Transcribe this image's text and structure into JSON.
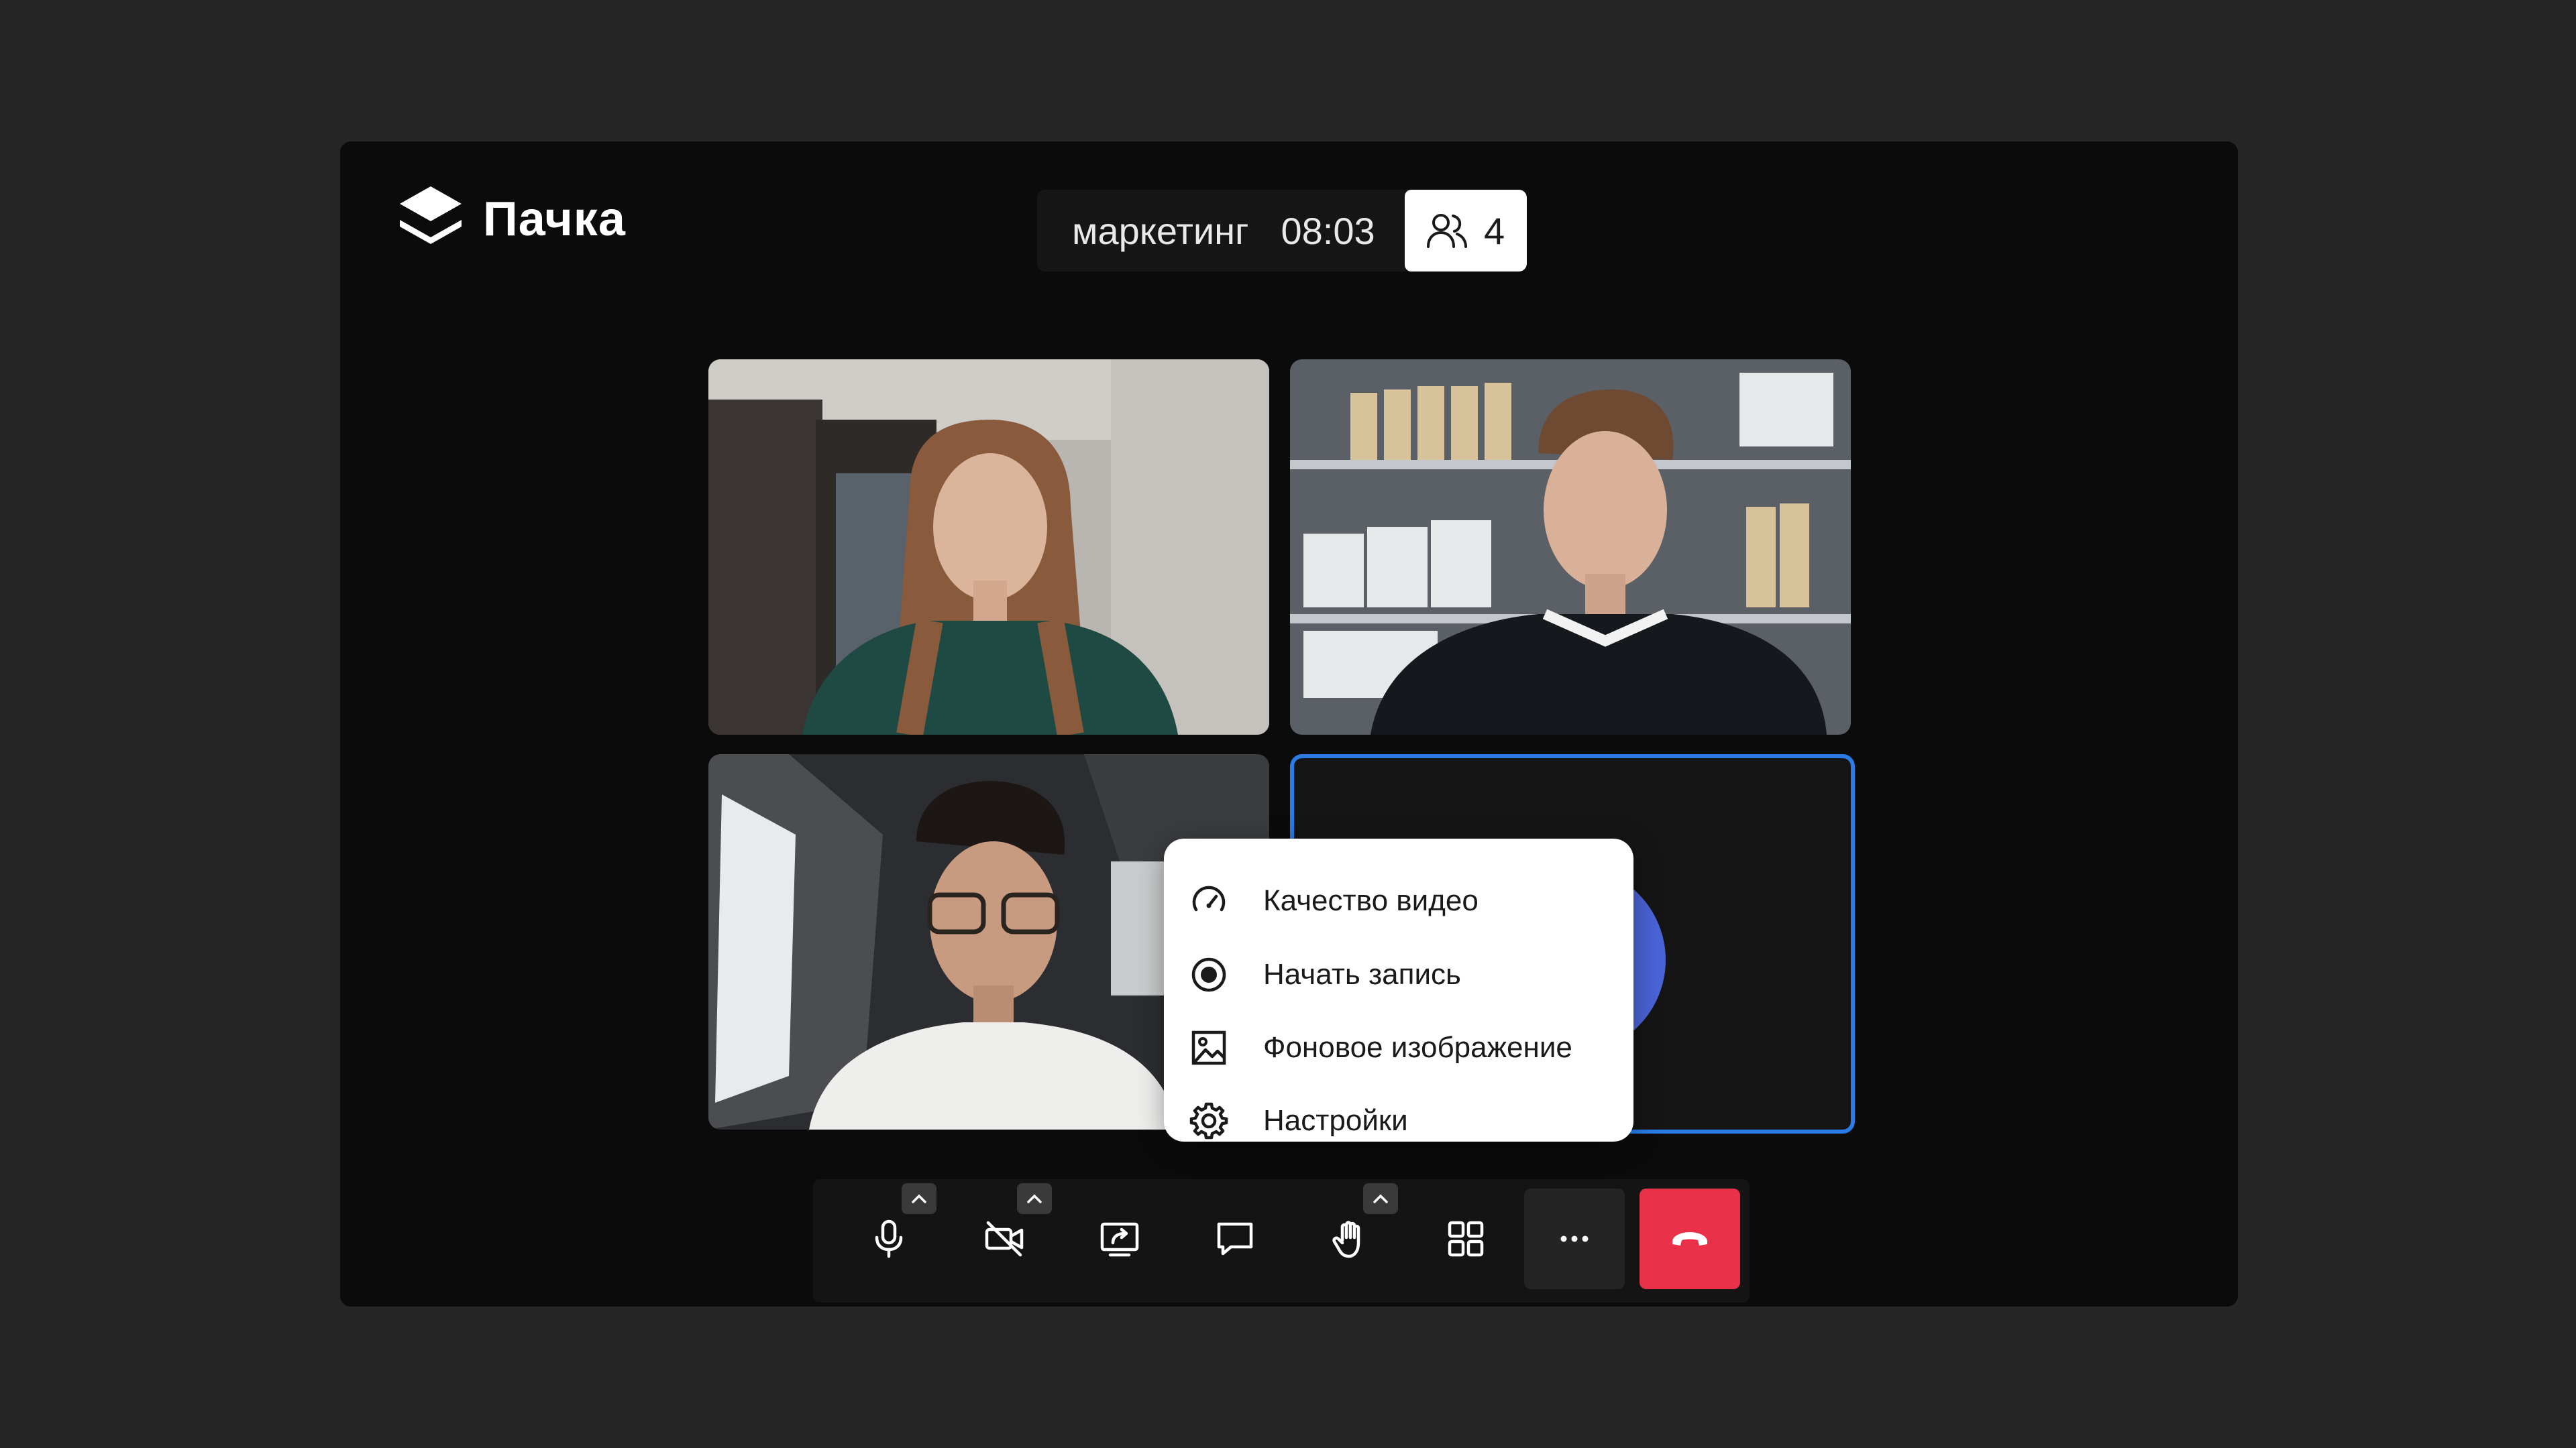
{
  "app": {
    "brand": "Пачка"
  },
  "call": {
    "name": "маркетинг",
    "timer": "08:03",
    "participants_count": "4"
  },
  "colors": {
    "window_bg": "#0b0b0b",
    "active_speaker_border": "#2a7be4",
    "end_call": "#e9324a",
    "avatar": "#4a63d6"
  },
  "more_menu": {
    "items": [
      {
        "icon": "speedometer-icon",
        "label": "Качество видео"
      },
      {
        "icon": "record-icon",
        "label": "Начать запись"
      },
      {
        "icon": "image-icon",
        "label": "Фоновое изображение"
      },
      {
        "icon": "gear-icon",
        "label": "Настройки"
      }
    ]
  },
  "toolbar": {
    "buttons": [
      {
        "icon": "microphone-icon",
        "has_caret": true
      },
      {
        "icon": "camera-off-icon",
        "has_caret": true
      },
      {
        "icon": "screen-share-icon",
        "has_caret": false
      },
      {
        "icon": "chat-icon",
        "has_caret": false
      },
      {
        "icon": "raise-hand-icon",
        "has_caret": true
      },
      {
        "icon": "grid-layout-icon",
        "has_caret": false
      },
      {
        "icon": "more-icon",
        "has_caret": false
      },
      {
        "icon": "end-call-icon",
        "has_caret": false
      }
    ]
  }
}
